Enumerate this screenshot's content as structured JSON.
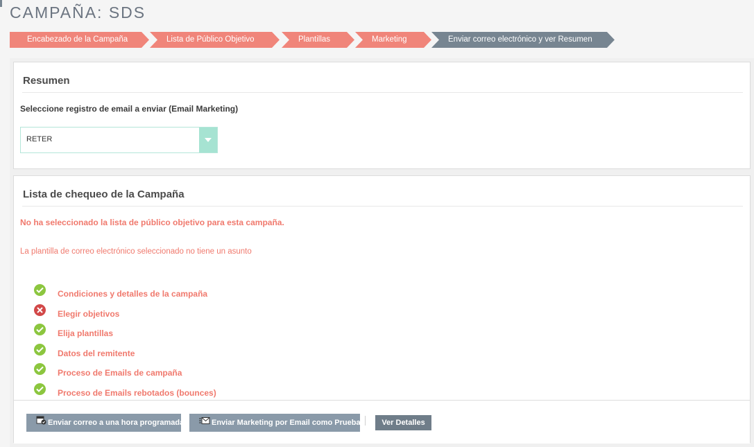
{
  "page": {
    "title": "CAMPAÑA: SDS"
  },
  "wizard": {
    "steps": [
      {
        "label": "Encabezado de la Campaña",
        "state": "done"
      },
      {
        "label": "Lista de Público Objetivo",
        "state": "done"
      },
      {
        "label": "Plantillas",
        "state": "done"
      },
      {
        "label": "Marketing",
        "state": "done"
      },
      {
        "label": "Enviar correo electrónico y ver Resumen",
        "state": "active"
      }
    ]
  },
  "summary": {
    "title": "Resumen",
    "select_label": "Seleccione registro de email a enviar (Email Marketing)",
    "select_value": "RETER"
  },
  "checklist": {
    "title": "Lista de chequeo de la Campaña",
    "warning_targets": "No ha seleccionado la lista de público objetivo para esta campaña.",
    "warning_subject": "La plantilla de correo electrónico seleccionado no tiene un asunto",
    "items": [
      {
        "label": "Condiciones y detalles de la campaña",
        "status": "ok"
      },
      {
        "label": "Elegir objetivos",
        "status": "error"
      },
      {
        "label": "Elija plantillas",
        "status": "ok"
      },
      {
        "label": "Datos del remitente",
        "status": "ok"
      },
      {
        "label": "Proceso de Emails de campaña",
        "status": "ok"
      },
      {
        "label": "Proceso de Emails rebotados (bounces)",
        "status": "ok"
      }
    ]
  },
  "actions": {
    "schedule_label": "Enviar correo a una hora programada",
    "test_label": "Enviar Marketing por Email como Pruebas",
    "details_label": "Ver Detalles"
  },
  "colors": {
    "accent": "#f0857a",
    "active_step": "#778591",
    "ok": "#8cc63f",
    "error": "#d24848",
    "select_arrow": "#a6e3d2"
  }
}
